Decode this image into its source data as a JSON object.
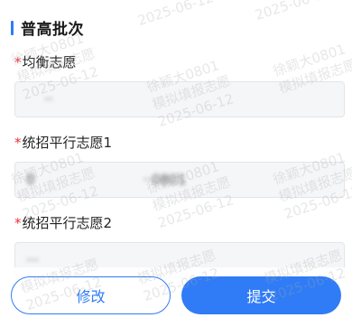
{
  "section": {
    "title": "普高批次"
  },
  "fields": [
    {
      "required_mark": "*",
      "label": "均衡志愿",
      "value": "··",
      "value2": ""
    },
    {
      "required_mark": "*",
      "label": "统招平行志愿1",
      "value": "0",
      "value2": "··0801"
    },
    {
      "required_mark": "*",
      "label": "统招平行志愿2",
      "value": "···",
      "value2": ""
    }
  ],
  "actions": {
    "edit_label": "修改",
    "submit_label": "提交"
  },
  "watermark": {
    "line1": "模拟填报志愿",
    "line2": "2025-06-12",
    "line3": "徐颖大0801"
  },
  "colors": {
    "accent": "#2f7cf6",
    "required": "#e8323c",
    "input_bg": "#f5f6f8"
  }
}
